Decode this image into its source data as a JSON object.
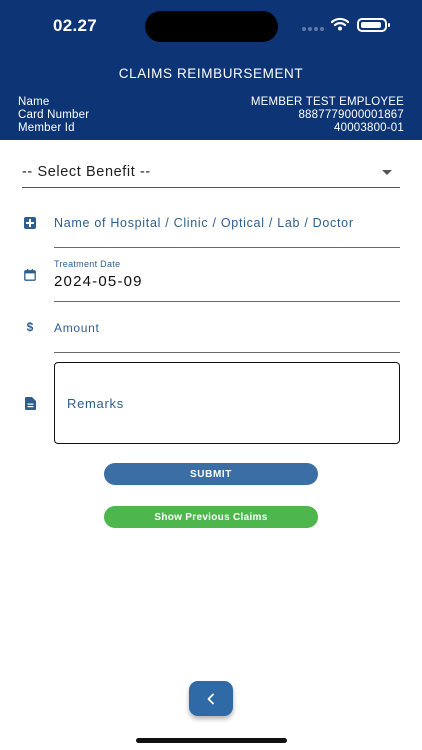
{
  "status_bar": {
    "time": "02.27"
  },
  "header": {
    "title": "CLAIMS REIMBURSEMENT",
    "rows": [
      {
        "label": "Name",
        "value": "MEMBER TEST EMPLOYEE"
      },
      {
        "label": "Card Number",
        "value": "8887779000001867"
      },
      {
        "label": "Member Id",
        "value": "40003800-01"
      }
    ]
  },
  "form": {
    "benefit_select": "-- Select Benefit --",
    "provider_placeholder": "Name of Hospital / Clinic / Optical / Lab / Doctor",
    "treatment_date_label": "Treatment Date",
    "treatment_date_value": "2024-05-09",
    "amount_placeholder": "Amount",
    "remarks_placeholder": "Remarks"
  },
  "buttons": {
    "submit": "SUBMIT",
    "show_previous": "Show Previous Claims"
  },
  "icons": {
    "provider": "hospital-plus-icon",
    "date": "calendar-icon",
    "amount": "dollar-icon",
    "remarks": "document-icon",
    "back": "chevron-left-icon"
  },
  "colors": {
    "header_bg": "#0d3576",
    "submit_bg": "#3b6ea5",
    "previous_bg": "#4db64d",
    "accent_text": "#2d5f8e"
  }
}
